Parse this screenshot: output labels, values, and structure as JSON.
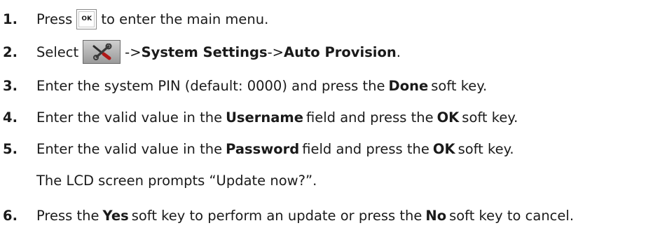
{
  "steps": [
    {
      "number": "1.",
      "before": "Press",
      "key_label": "OK",
      "after": "to enter the main menu."
    },
    {
      "number": "2.",
      "before": "Select",
      "arrow1": "->",
      "menu1": "System Settings",
      "arrow2": "->",
      "menu2": "Auto Provision",
      "end": "."
    },
    {
      "number": "3.",
      "before": "Enter the system PIN (default: 0000) and press the",
      "bold": "Done",
      "after": "soft key."
    },
    {
      "number": "4.",
      "before": "Enter the valid value in the",
      "bold1": "Username",
      "middle": "field and press the",
      "bold2": "OK",
      "after": "soft key."
    },
    {
      "number": "5.",
      "before": "Enter the valid value in the",
      "bold1": "Password",
      "middle": "field and press the",
      "bold2": "OK",
      "after": "soft key."
    },
    {
      "number": "6.",
      "before": "Press the",
      "bold1": "Yes",
      "middle": "soft key to perform an update or press the",
      "bold2": "No",
      "after": "soft key to cancel."
    }
  ],
  "note": "The LCD screen prompts “Update now?”.",
  "icons": {
    "ok_key": "ok-key-icon",
    "settings": "settings-tools-icon"
  }
}
